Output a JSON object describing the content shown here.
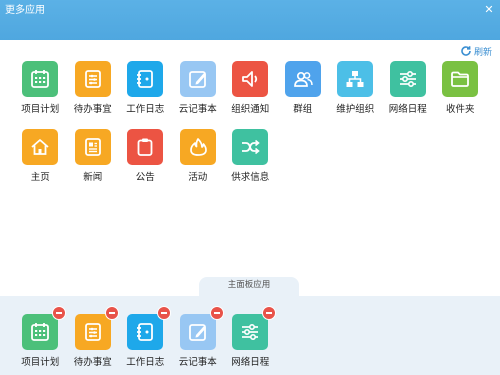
{
  "window": {
    "title": "更多应用",
    "close_glyph": "✕"
  },
  "refresh": {
    "label": "刷新",
    "icon": "refresh-icon",
    "color": "#3b8fd2"
  },
  "apps": [
    {
      "label": "项目计划",
      "icon": "calendar-icon",
      "color": "#4cc07a"
    },
    {
      "label": "待办事宜",
      "icon": "list-icon",
      "color": "#f7a823"
    },
    {
      "label": "工作日志",
      "icon": "notebook-icon",
      "color": "#1ea8ea"
    },
    {
      "label": "云记事本",
      "icon": "note-edit-icon",
      "color": "#98c7f3"
    },
    {
      "label": "组织通知",
      "icon": "speaker-icon",
      "color": "#ec5443"
    },
    {
      "label": "群组",
      "icon": "group-icon",
      "color": "#4fa3ec"
    },
    {
      "label": "维护组织",
      "icon": "org-chart-icon",
      "color": "#4cbfe7"
    },
    {
      "label": "网络日程",
      "icon": "sliders-icon",
      "color": "#3fc1a0"
    },
    {
      "label": "收件夹",
      "icon": "folder-icon",
      "color": "#7ac142"
    },
    {
      "label": "主页",
      "icon": "home-icon",
      "color": "#f7a823"
    },
    {
      "label": "新闻",
      "icon": "news-icon",
      "color": "#f7a823"
    },
    {
      "label": "公告",
      "icon": "clipboard-icon",
      "color": "#ec5443"
    },
    {
      "label": "活动",
      "icon": "flame-icon",
      "color": "#f7a823"
    },
    {
      "label": "供求信息",
      "icon": "shuffle-icon",
      "color": "#3fc1a0"
    }
  ],
  "dock": {
    "title": "主面板应用",
    "apps": [
      {
        "label": "项目计划",
        "icon": "calendar-icon",
        "color": "#4cc07a"
      },
      {
        "label": "待办事宜",
        "icon": "list-icon",
        "color": "#f7a823"
      },
      {
        "label": "工作日志",
        "icon": "notebook-icon",
        "color": "#1ea8ea"
      },
      {
        "label": "云记事本",
        "icon": "note-edit-icon",
        "color": "#98c7f3"
      },
      {
        "label": "网络日程",
        "icon": "sliders-icon",
        "color": "#3fc1a0"
      }
    ]
  }
}
